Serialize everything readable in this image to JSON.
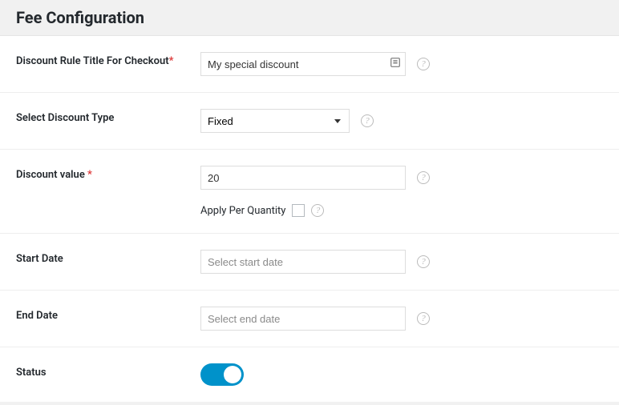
{
  "header": {
    "title": "Fee Configuration"
  },
  "rows": {
    "title": {
      "label": "Discount Rule Title For Checkout",
      "required": true,
      "value": "My special discount"
    },
    "type": {
      "label": "Select Discount Type",
      "selected": "Fixed"
    },
    "value": {
      "label": "Discount value ",
      "required": true,
      "value": "20",
      "apply_label": "Apply Per Quantity"
    },
    "start": {
      "label": "Start Date",
      "placeholder": "Select start date",
      "value": ""
    },
    "end": {
      "label": "End Date",
      "placeholder": "Select end date",
      "value": ""
    },
    "status": {
      "label": "Status",
      "enabled": true
    }
  },
  "colors": {
    "accent": "#0092ca",
    "required": "#dc3232"
  }
}
